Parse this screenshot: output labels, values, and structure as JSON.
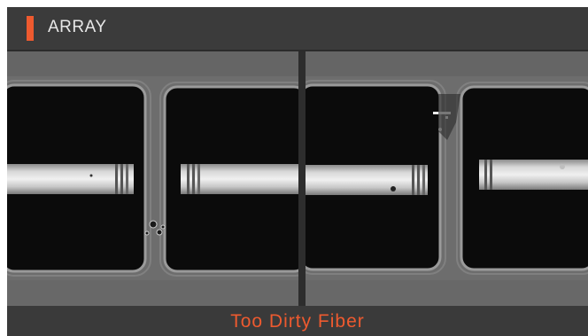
{
  "header": {
    "title": "ARRAY",
    "accent_color": "#ee5a2f"
  },
  "views": [
    {
      "name": "left-fiber-view"
    },
    {
      "name": "right-fiber-view"
    }
  ],
  "status": {
    "message": "Too Dirty Fiber",
    "color": "#ee5a2f"
  }
}
